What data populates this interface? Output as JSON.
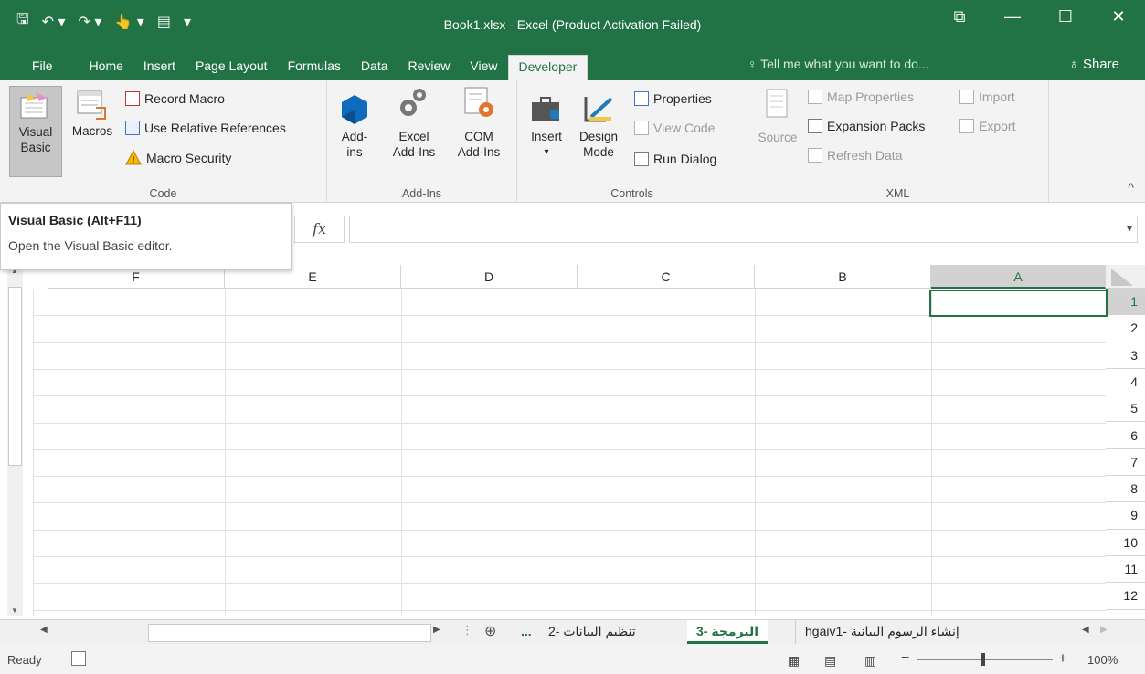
{
  "titlebar": {
    "title": "Book1.xlsx - Excel (Product Activation Failed)",
    "qat_icons": [
      "save-icon",
      "undo-icon",
      "redo-icon",
      "touch-mode-icon",
      "form-icon",
      "customize-qat-icon"
    ],
    "qat_glyphs": [
      "🖫",
      "↶ ▾",
      "↷ ▾",
      "👆 ▾",
      "▤",
      "▾"
    ],
    "window_controls": [
      "⧉",
      "—",
      "☐",
      "✕"
    ]
  },
  "tabs": [
    "File",
    "Home",
    "Insert",
    "Page Layout",
    "Formulas",
    "Data",
    "Review",
    "View",
    "Developer"
  ],
  "active_tab": "Developer",
  "tell_me": "♀ Tell me what you want to do...",
  "share": "♁ Share",
  "ribbon": {
    "code": {
      "label": "Code",
      "visual_basic": [
        "Visual",
        "Basic"
      ],
      "macros": "Macros",
      "record_macro": "Record Macro",
      "use_relative": "Use Relative References",
      "macro_security": "Macro Security"
    },
    "addins": {
      "label": "Add-Ins",
      "addins_btn": [
        "Add-",
        "ins"
      ],
      "excel_addins": [
        "Excel",
        "Add-Ins"
      ],
      "com_addins": [
        "COM",
        "Add-Ins"
      ]
    },
    "controls": {
      "label": "Controls",
      "insert": "Insert",
      "insert_arrow": "▾",
      "design_mode": [
        "Design",
        "Mode"
      ],
      "properties": "Properties",
      "view_code": "View Code",
      "run_dialog": "Run Dialog"
    },
    "xml": {
      "label": "XML",
      "source": "Source",
      "map_properties": "Map Properties",
      "expansion_packs": "Expansion Packs",
      "refresh_data": "Refresh Data",
      "import": "Import",
      "export": "Export"
    },
    "collapse": "^"
  },
  "tooltip": {
    "title": "Visual Basic (Alt+F11)",
    "description": "Open the Visual Basic editor."
  },
  "formula_bar": {
    "fx": "fx",
    "value": "",
    "dropdown": "▾"
  },
  "grid": {
    "columns": [
      "F",
      "E",
      "D",
      "C",
      "B",
      "A"
    ],
    "selected_column": "A",
    "rows": [
      "1",
      "2",
      "3",
      "4",
      "5",
      "6",
      "7",
      "8",
      "9",
      "10",
      "11",
      "12"
    ],
    "selected_row": "1"
  },
  "sheets": {
    "tabs": [
      "hgaivإنشاء الرسوم البيانية -1",
      "البرمجة -3",
      "تنظيم البيانات -2",
      "..."
    ],
    "active": "البرمجة -3",
    "add": "⊕"
  },
  "status": {
    "ready": "Ready",
    "zoom": "100%",
    "zoom_minus": "−",
    "zoom_plus": "+"
  },
  "colors": {
    "accent": "#217346",
    "ribbon": "#f3f3f3"
  }
}
